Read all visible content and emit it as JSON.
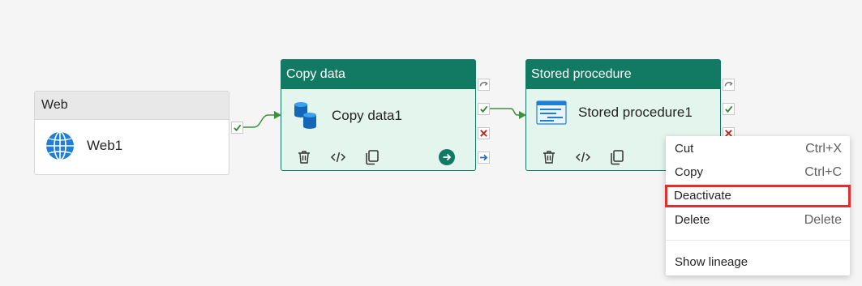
{
  "canvas": {
    "background": "#f5f5f5"
  },
  "colors": {
    "activity_header": "#127a62",
    "activity_body": "#e3f5ec",
    "link": "#3f8f3f",
    "highlight": "#e02f2f"
  },
  "web_activity": {
    "type_label": "Web",
    "name": "Web1",
    "icon": "globe-icon",
    "output_status": "success-check-icon"
  },
  "copy_activity": {
    "type_label": "Copy data",
    "name": "Copy data1",
    "icon": "copy-data-icon",
    "tools": [
      "delete-icon",
      "code-icon",
      "clone-icon"
    ],
    "run_icon": "arrow-right-circle-icon",
    "outputs": [
      "skip-icon",
      "success-check-icon",
      "failure-x-icon",
      "completion-arrow-icon"
    ]
  },
  "sp_activity": {
    "type_label": "Stored procedure",
    "name": "Stored procedure1",
    "icon": "stored-procedure-icon",
    "tools": [
      "delete-icon",
      "code-icon",
      "clone-icon"
    ],
    "outputs": [
      "skip-icon",
      "success-check-icon",
      "failure-x-icon"
    ]
  },
  "context_menu": {
    "items": [
      {
        "label": "Cut",
        "shortcut": "Ctrl+X"
      },
      {
        "label": "Copy",
        "shortcut": "Ctrl+C"
      },
      {
        "label": "Deactivate",
        "shortcut": "",
        "highlighted": true
      },
      {
        "label": "Delete",
        "shortcut": "Delete"
      },
      {
        "label": "Show lineage",
        "shortcut": ""
      }
    ]
  }
}
